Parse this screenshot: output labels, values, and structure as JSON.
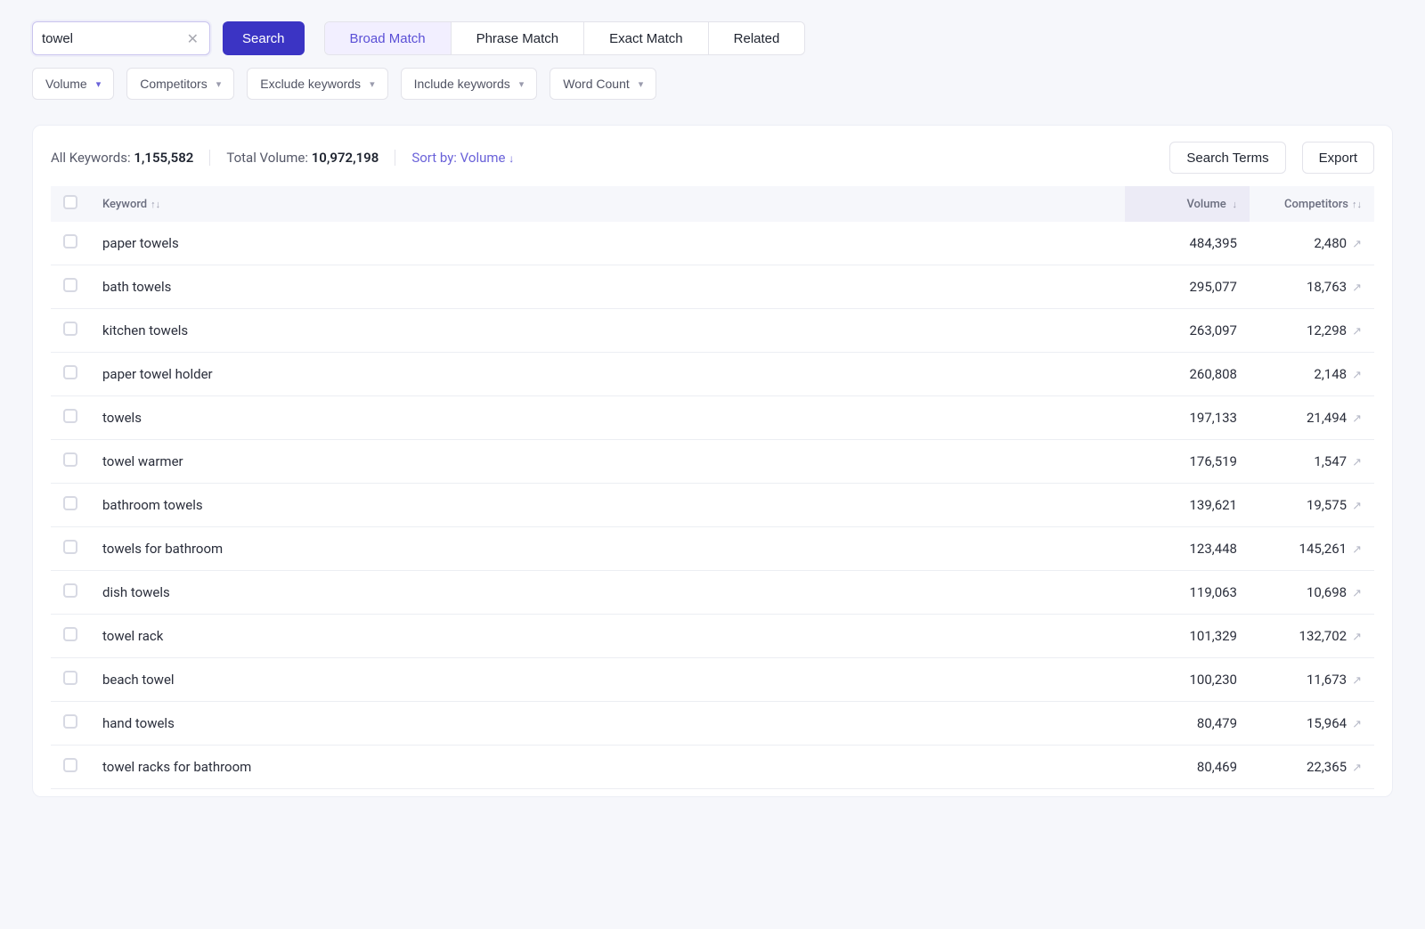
{
  "search": {
    "value": "towel",
    "button": "Search"
  },
  "match_tabs": [
    {
      "label": "Broad Match"
    },
    {
      "label": "Phrase Match"
    },
    {
      "label": "Exact Match"
    },
    {
      "label": "Related"
    }
  ],
  "filters": [
    {
      "label": "Volume"
    },
    {
      "label": "Competitors"
    },
    {
      "label": "Exclude keywords"
    },
    {
      "label": "Include keywords"
    },
    {
      "label": "Word Count"
    }
  ],
  "summary": {
    "all_keywords_label": "All Keywords: ",
    "all_keywords_value": "1,155,582",
    "total_volume_label": "Total Volume: ",
    "total_volume_value": "10,972,198",
    "sort_by_label": "Sort by: ",
    "sort_by_value": "Volume"
  },
  "actions": {
    "search_terms": "Search Terms",
    "export": "Export"
  },
  "columns": {
    "keyword": "Keyword",
    "volume": "Volume",
    "competitors": "Competitors"
  },
  "rows": [
    {
      "keyword": "paper towels",
      "volume": "484,395",
      "competitors": "2,480"
    },
    {
      "keyword": "bath towels",
      "volume": "295,077",
      "competitors": "18,763"
    },
    {
      "keyword": "kitchen towels",
      "volume": "263,097",
      "competitors": "12,298"
    },
    {
      "keyword": "paper towel holder",
      "volume": "260,808",
      "competitors": "2,148"
    },
    {
      "keyword": "towels",
      "volume": "197,133",
      "competitors": "21,494"
    },
    {
      "keyword": "towel warmer",
      "volume": "176,519",
      "competitors": "1,547"
    },
    {
      "keyword": "bathroom towels",
      "volume": "139,621",
      "competitors": "19,575"
    },
    {
      "keyword": "towels for bathroom",
      "volume": "123,448",
      "competitors": "145,261"
    },
    {
      "keyword": "dish towels",
      "volume": "119,063",
      "competitors": "10,698"
    },
    {
      "keyword": "towel rack",
      "volume": "101,329",
      "competitors": "132,702"
    },
    {
      "keyword": "beach towel",
      "volume": "100,230",
      "competitors": "11,673"
    },
    {
      "keyword": "hand towels",
      "volume": "80,479",
      "competitors": "15,964"
    },
    {
      "keyword": "towel racks for bathroom",
      "volume": "80,469",
      "competitors": "22,365"
    }
  ]
}
